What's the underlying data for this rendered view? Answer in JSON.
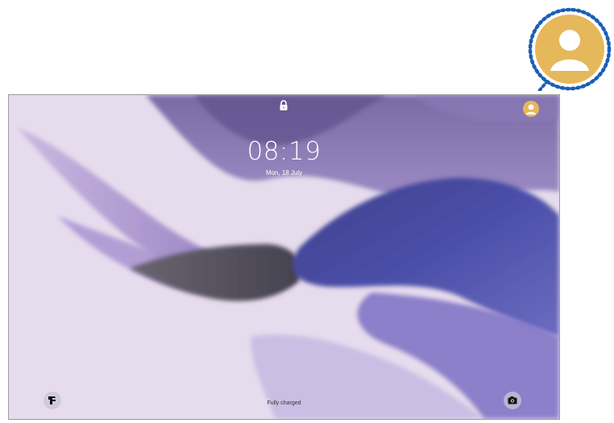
{
  "lockscreen": {
    "time": "08:19",
    "date": "Mon, 18 July",
    "status": "Fully charged"
  },
  "icons": {
    "lock": "lock-icon",
    "profile": "user-profile-icon",
    "left_shortcut": "phone-icon",
    "right_shortcut": "camera-icon"
  },
  "colors": {
    "background": "#e6dced",
    "profile_accent": "#e6b85c",
    "callout_ring": "#1a5fb4"
  }
}
